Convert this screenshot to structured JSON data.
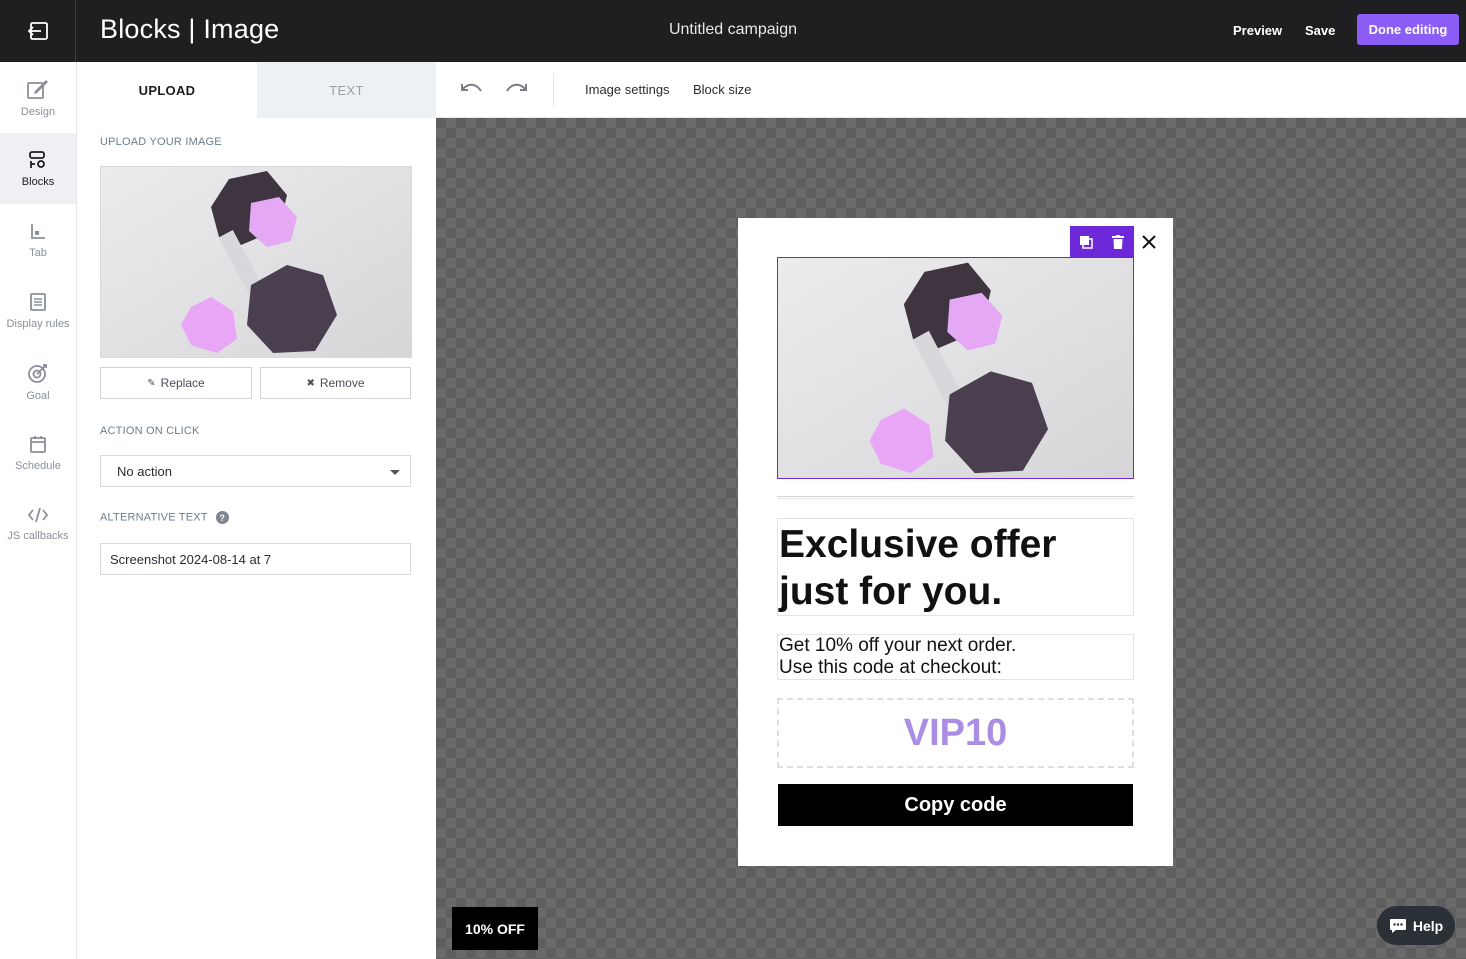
{
  "topbar": {
    "title": "Blocks | Image",
    "campaign_name": "Untitled campaign",
    "preview_label": "Preview",
    "save_label": "Save",
    "done_label": "Done editing",
    "accent_color": "#8b5cf6"
  },
  "rail": {
    "items": [
      {
        "label": "Design",
        "icon": "pencil-square-icon"
      },
      {
        "label": "Blocks",
        "icon": "blocks-icon",
        "active": true
      },
      {
        "label": "Tab",
        "icon": "tab-icon"
      },
      {
        "label": "Display rules",
        "icon": "list-document-icon"
      },
      {
        "label": "Goal",
        "icon": "target-icon"
      },
      {
        "label": "Schedule",
        "icon": "calendar-icon"
      },
      {
        "label": "JS callbacks",
        "icon": "code-icon"
      }
    ]
  },
  "panel": {
    "tabs": [
      "UPLOAD",
      "TEXT"
    ],
    "upload_label": "UPLOAD YOUR IMAGE",
    "replace_label": "Replace",
    "remove_label": "Remove",
    "action_label": "ACTION ON CLICK",
    "action_value": "No action",
    "alt_label": "ALTERNATIVE TEXT",
    "alt_value": "Screenshot 2024-08-14 at 7"
  },
  "toolbar": {
    "image_settings": "Image settings",
    "block_size": "Block size"
  },
  "popup": {
    "headline_line1": "Exclusive offer",
    "headline_line2": "just for you.",
    "body_line1": "Get 10% off your next order.",
    "body_line2": "Use this code at checkout:",
    "code": "VIP10",
    "copy_label": "Copy code",
    "selection_color": "#6d28d9"
  },
  "teaser_label": "10% OFF",
  "help_label": "Help"
}
